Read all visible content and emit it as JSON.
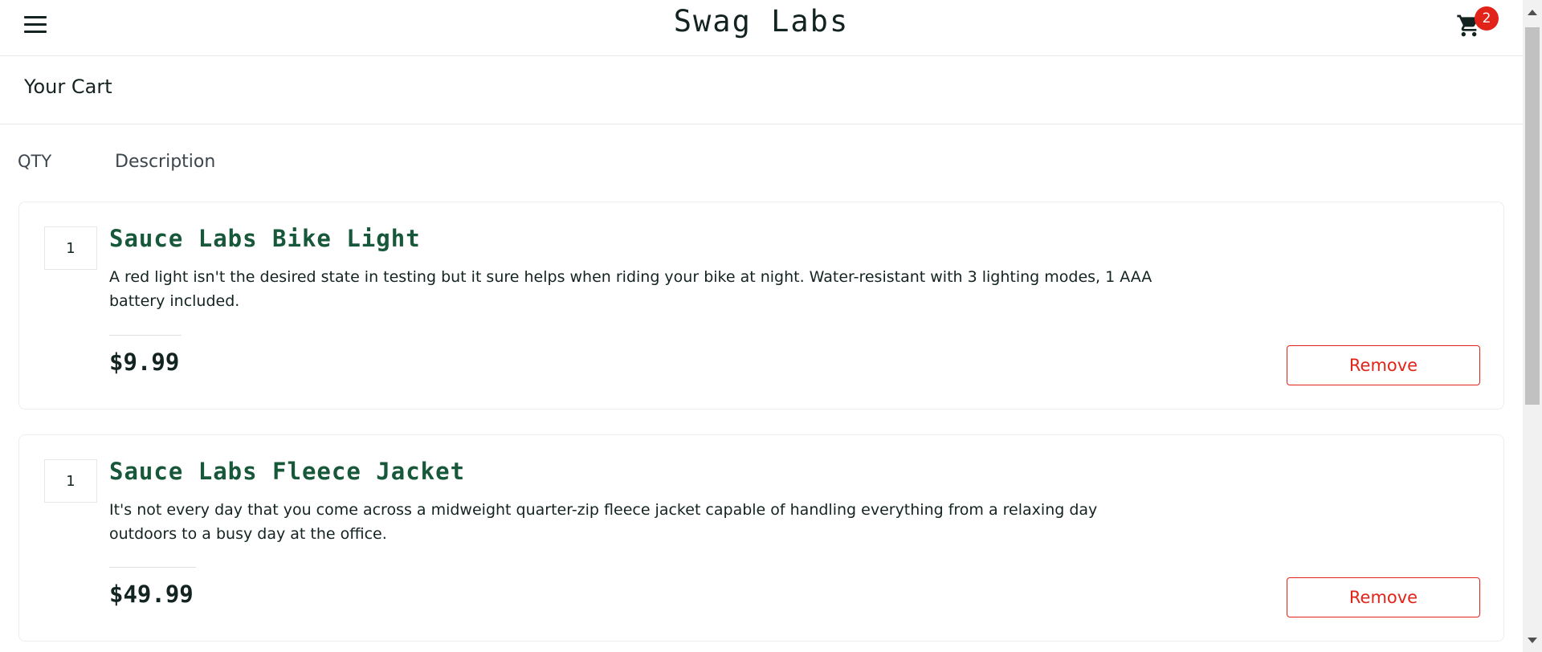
{
  "header": {
    "logo": "Swag Labs",
    "menu_icon": "hamburger-menu-icon",
    "cart_icon": "shopping-cart-icon",
    "cart_badge": "2"
  },
  "subheader": {
    "title": "Your Cart"
  },
  "columns": {
    "qty": "QTY",
    "description": "Description"
  },
  "items": [
    {
      "qty": "1",
      "name": "Sauce Labs Bike Light",
      "description": "A red light isn't the desired state in testing but it sure helps when riding your bike at night. Water-resistant with 3 lighting modes, 1 AAA battery included.",
      "price": "$9.99",
      "remove_label": "Remove"
    },
    {
      "qty": "1",
      "name": "Sauce Labs Fleece Jacket",
      "description": "It's not every day that you come across a midweight quarter-zip fleece jacket capable of handling everything from a relaxing day outdoors to a busy day at the office.",
      "price": "$49.99",
      "remove_label": "Remove"
    }
  ],
  "colors": {
    "brand_text": "#132322",
    "item_title": "#18583a",
    "accent_red": "#e2231a"
  }
}
